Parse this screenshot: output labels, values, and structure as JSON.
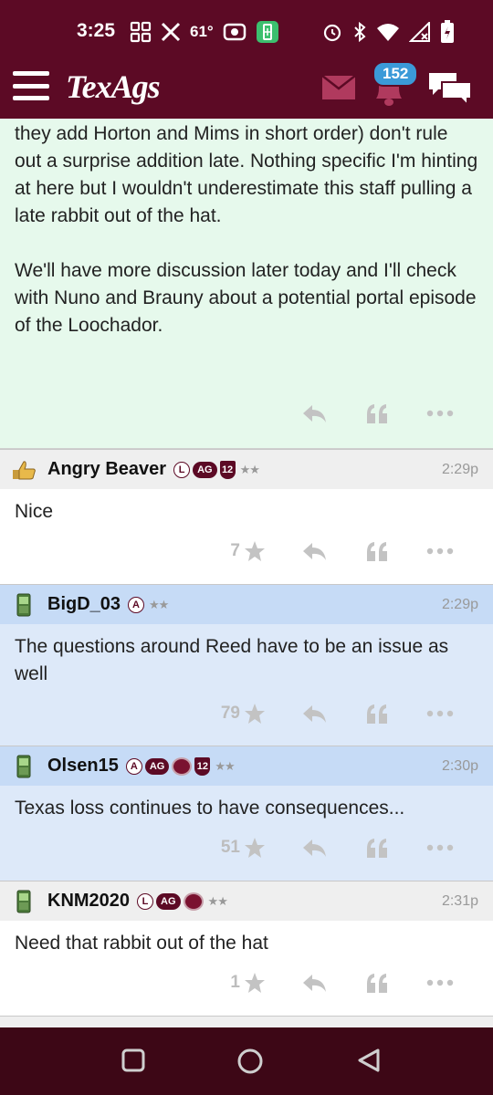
{
  "status_bar": {
    "time": "3:25",
    "temperature": "61°",
    "icons_left": [
      "grid-icon",
      "x-logo-icon",
      "radio-icon",
      "battery-saver-icon"
    ],
    "icons_right": [
      "alarm-icon",
      "bluetooth-icon",
      "wifi-icon",
      "signal-icon",
      "battery-icon"
    ]
  },
  "header": {
    "app_title": "TexAgs",
    "notification_count": "152",
    "colors": {
      "brand": "#5c0a25",
      "badge": "#3b9ad8"
    }
  },
  "main_post": {
    "paragraph1": "they add Horton and Mims in short order) don't rule out a surprise addition late. Nothing specific I'm hinting at here but I wouldn't underestimate this staff pulling a late rabbit out of the hat.",
    "paragraph2": "We'll have more discussion later today and I'll check with Nuno and Brauny about a potential portal episode of the Loochador.",
    "background": "#e6f9ec"
  },
  "replies": [
    {
      "username": "Angry Beaver",
      "time": "2:29p",
      "icon": "thumbs-up-hand-icon",
      "badges": [
        "L",
        "AG",
        "12",
        "★★"
      ],
      "text": "Nice",
      "stars": "7"
    },
    {
      "username": "BigD_03",
      "time": "2:29p",
      "icon": "phone-icon",
      "badges": [
        "A",
        "★★"
      ],
      "text": "The questions around Reed have to be an issue as well",
      "stars": "79"
    },
    {
      "username": "Olsen15",
      "time": "2:30p",
      "icon": "phone-icon",
      "badges": [
        "A",
        "AG",
        "seal",
        "12",
        "★★"
      ],
      "text": "Texas loss continues to have consequences...",
      "stars": "51"
    },
    {
      "username": "KNM2020",
      "time": "2:31p",
      "icon": "phone-icon",
      "badges": [
        "L",
        "AG",
        "seal",
        "★★"
      ],
      "text": "Need that rabbit out of the hat",
      "stars": "1"
    }
  ]
}
